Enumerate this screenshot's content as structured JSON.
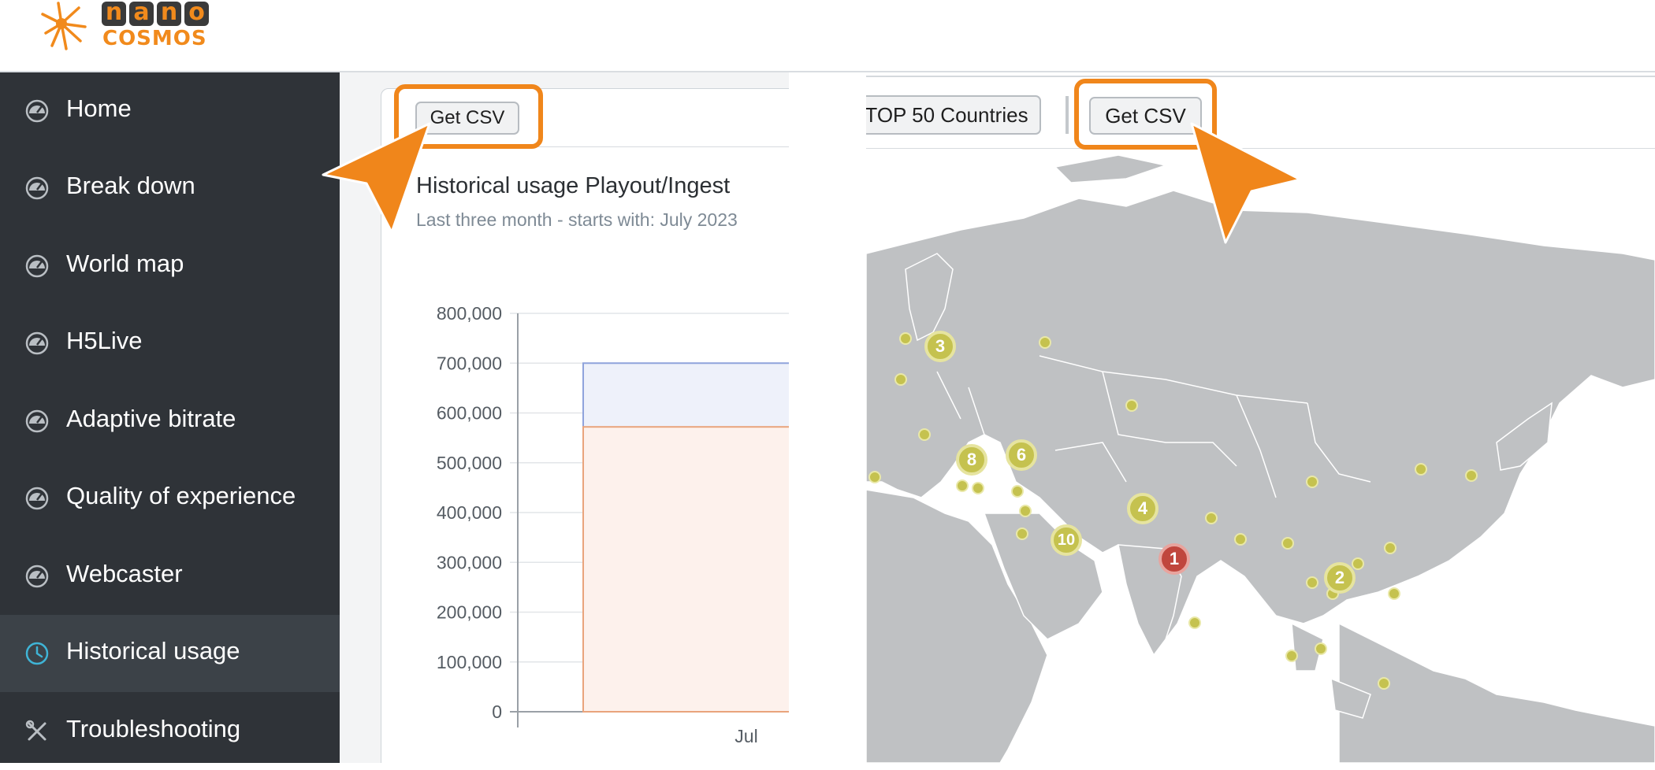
{
  "brand": {
    "letters": [
      "n",
      "a",
      "n",
      "o"
    ],
    "sub": "COSMOS",
    "accent_color": "#f18a1c"
  },
  "sidebar": {
    "items": [
      {
        "label": "Home",
        "icon": "speedometer-icon"
      },
      {
        "label": "Break down",
        "icon": "speedometer-icon"
      },
      {
        "label": "World map",
        "icon": "speedometer-icon"
      },
      {
        "label": "H5Live",
        "icon": "speedometer-icon"
      },
      {
        "label": "Adaptive bitrate",
        "icon": "speedometer-icon"
      },
      {
        "label": "Quality of experience",
        "icon": "speedometer-icon"
      },
      {
        "label": "Webcaster",
        "icon": "speedometer-icon"
      },
      {
        "label": "Historical usage",
        "icon": "clock-icon",
        "active": true
      },
      {
        "label": "Troubleshooting",
        "icon": "tools-icon"
      }
    ]
  },
  "left_panel": {
    "get_csv_label": "Get CSV",
    "chart_title": "Historical usage Playout/Ingest",
    "chart_subtitle": "Last three month - starts with: July 2023"
  },
  "chart_data": {
    "type": "bar",
    "title": "Historical usage Playout/Ingest",
    "subtitle": "Last three month - starts with: July 2023",
    "categories": [
      "Jul"
    ],
    "series": [
      {
        "values": [
          700000
        ],
        "color": "#8fa3dc"
      },
      {
        "values": [
          572000
        ],
        "color": "#e9a47c"
      }
    ],
    "y_ticks": [
      "800,000",
      "700,000",
      "600,000",
      "500,000",
      "400,000",
      "300,000",
      "200,000",
      "100,000",
      "0"
    ],
    "ylim": [
      0,
      800000
    ],
    "grid": true
  },
  "right_panel": {
    "top50_label": "TOP 50 Countries",
    "get_csv_label": "Get CSV",
    "map_markers": [
      {
        "label": "3"
      },
      {
        "label": "8"
      },
      {
        "label": "6"
      },
      {
        "label": "4"
      },
      {
        "label": "10"
      },
      {
        "label": "1"
      },
      {
        "label": "2"
      }
    ]
  }
}
